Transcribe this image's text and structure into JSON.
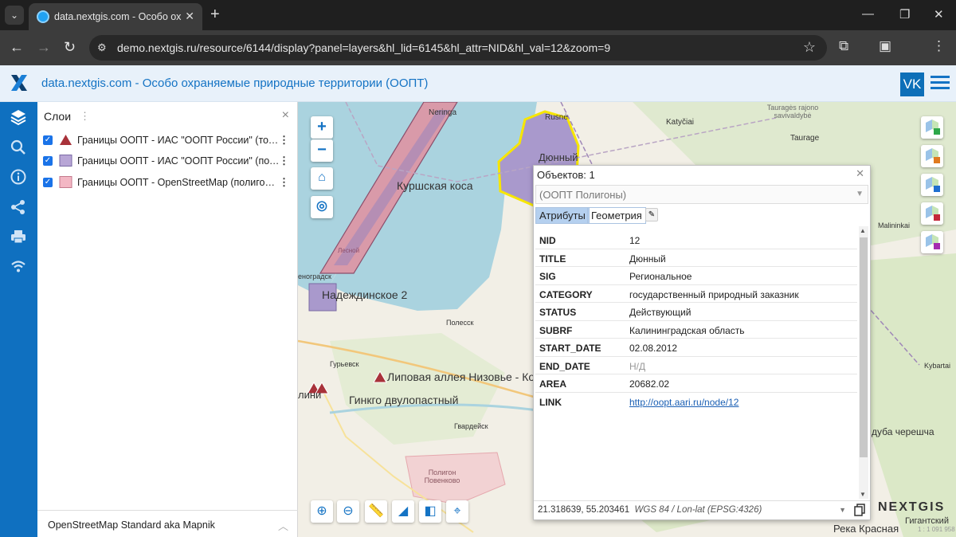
{
  "browser": {
    "tab_title": "data.nextgis.com - Особо охра",
    "url": "demo.nextgis.ru/resource/6144/display?panel=layers&hl_lid=6145&hl_attr=NID&hl_val=12&zoom=9"
  },
  "header": {
    "title": "data.nextgis.com - Особо охраняемые природные территории (ООПТ)",
    "vk_label": "VK"
  },
  "layers_panel": {
    "title": "Слои",
    "dots": "⋮",
    "close": "×",
    "layers": [
      {
        "label": "Границы ООПТ - ИАС \"ООПТ России\" (точки)",
        "symbol": "triangle"
      },
      {
        "label": "Границы ООПТ - ИАС \"ООПТ России\" (полигоны)",
        "symbol": "purple-square"
      },
      {
        "label": "Границы ООПТ - OpenStreetMap (полигоны)",
        "symbol": "pink-square"
      }
    ],
    "basemap": "OpenStreetMap Standard aka Mapnik"
  },
  "map": {
    "labels": {
      "kurshskaya": "Куршская коса",
      "nadezhdinskoe": "Надеждинское 2",
      "lipovaya": "Липовая аллея Низовье - Ко",
      "ginkgo": "Гинкго двулопастный",
      "dyunny": "Дюнный",
      "poligon": "Полигон Повенково",
      "neringa": "Neringa",
      "rusne": "Rusnė",
      "katyciai": "Katyčiai",
      "taurages": "Tauragės rajono savivaldybė",
      "taurage": "Taurage",
      "lesnoy": "Лесной",
      "zelenogradsk": "еноградск",
      "polessk": "Полесск",
      "guryevsk": "Гурьевск",
      "gvardeysk": "Гвардейск",
      "kalin": "лини",
      "malininkai": "Malininkai",
      "kybartai": "Kybartai",
      "reka": "Река Красная",
      "dubacherem": "дуба черешча",
      "gigant": "Гигантский"
    },
    "scale": "1 : 1 091 958",
    "logo": "NEXTGIS"
  },
  "popup": {
    "header": "Объектов: 1",
    "select": "(ООПТ Полигоны)",
    "tabs": [
      "Атрибуты",
      "Геометрия"
    ],
    "attributes": [
      {
        "key": "NID",
        "value": "12"
      },
      {
        "key": "TITLE",
        "value": "Дюнный"
      },
      {
        "key": "SIG",
        "value": "Региональное"
      },
      {
        "key": "CATEGORY",
        "value": "государственный природный заказник"
      },
      {
        "key": "STATUS",
        "value": "Действующий"
      },
      {
        "key": "SUBRF",
        "value": "Калининградская область"
      },
      {
        "key": "START_DATE",
        "value": "02.08.2012"
      },
      {
        "key": "END_DATE",
        "value": "Н/Д"
      },
      {
        "key": "AREA",
        "value": "20682.02"
      },
      {
        "key": "LINK",
        "value": "http://oopt.aari.ru/node/12"
      }
    ],
    "coords": "21.318639, 55.203461",
    "crs": "WGS 84 / Lon-lat (EPSG:4326)"
  },
  "colors": {
    "rail": "#0f70c0",
    "accent": "#1473c4",
    "water": "#aad3df",
    "ptab_active": "#b5d0ef"
  }
}
